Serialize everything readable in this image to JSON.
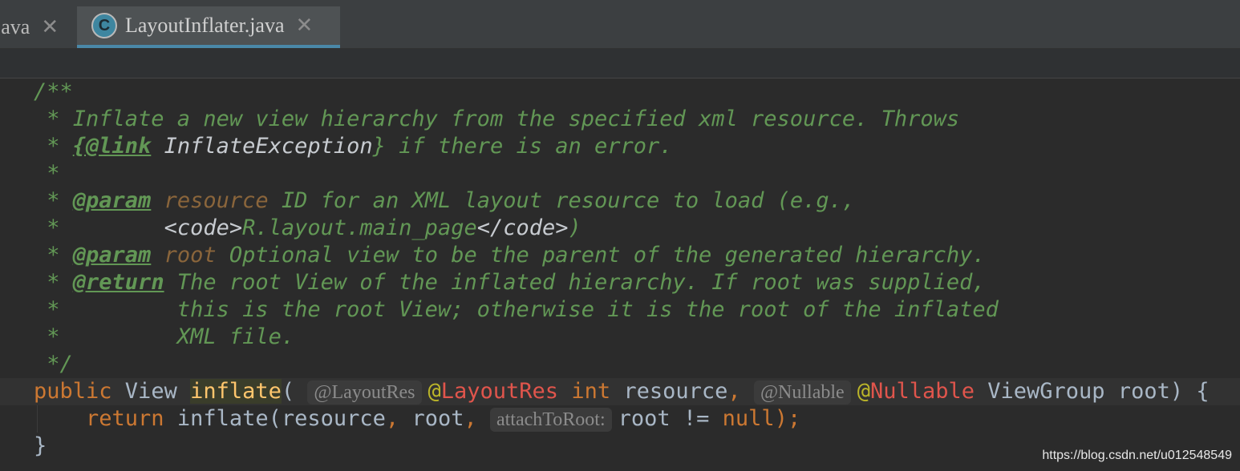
{
  "tabs": [
    {
      "label": "java",
      "close": "✕"
    },
    {
      "label": "LayoutInflater.java",
      "close": "✕",
      "icon_letter": "C"
    }
  ],
  "code": {
    "l1": "/**",
    "l2": " * Inflate a new view hierarchy from the specified xml resource. Throws",
    "l3_pre": " * ",
    "l3_tag": "{@link",
    "l3_ref": " InflateException",
    "l3_post": "} if there is an error.",
    "l4": " *",
    "l5_pre": " * ",
    "l5_tag": "@param",
    "l5_name": " resource",
    "l5_post": " ID for an XML layout resource to load (e.g.,",
    "l6_pre": " *        ",
    "l6_open": "<code>",
    "l6_mid": "R.layout.main_page",
    "l6_close": "</code>",
    "l6_post": ")",
    "l7_pre": " * ",
    "l7_tag": "@param",
    "l7_name": " root",
    "l7_post": " Optional view to be the parent of the generated hierarchy.",
    "l8_pre": " * ",
    "l8_tag": "@return",
    "l8_post": " The root View of the inflated hierarchy. If root was supplied,",
    "l9": " *         this is the root View; otherwise it is the root of the inflated",
    "l10": " *         XML file.",
    "l11": " */",
    "l12_public": "public",
    "l12_view": " View ",
    "l12_fn": "inflate",
    "l12_paren": "( ",
    "l12_hint1": "@LayoutRes",
    "l12_at1": "@",
    "l12_anno1": "LayoutRes",
    "l12_int": " int",
    "l12_res": " resource",
    "l12_comma": ", ",
    "l12_hint2": "@Nullable",
    "l12_at2": "@",
    "l12_anno2": "Nullable",
    "l12_tail": " ViewGroup root) {",
    "l13_indent": "    ",
    "l13_return": "return",
    "l13_call": " inflate(resource",
    "l13_c1": ",",
    "l13_root": " root",
    "l13_c2": ", ",
    "l13_hint": "attachToRoot:",
    "l13_expr": "root != ",
    "l13_null": "null",
    "l13_end": ");",
    "l14": "}"
  },
  "watermark": "https://blog.csdn.net/u012548549"
}
